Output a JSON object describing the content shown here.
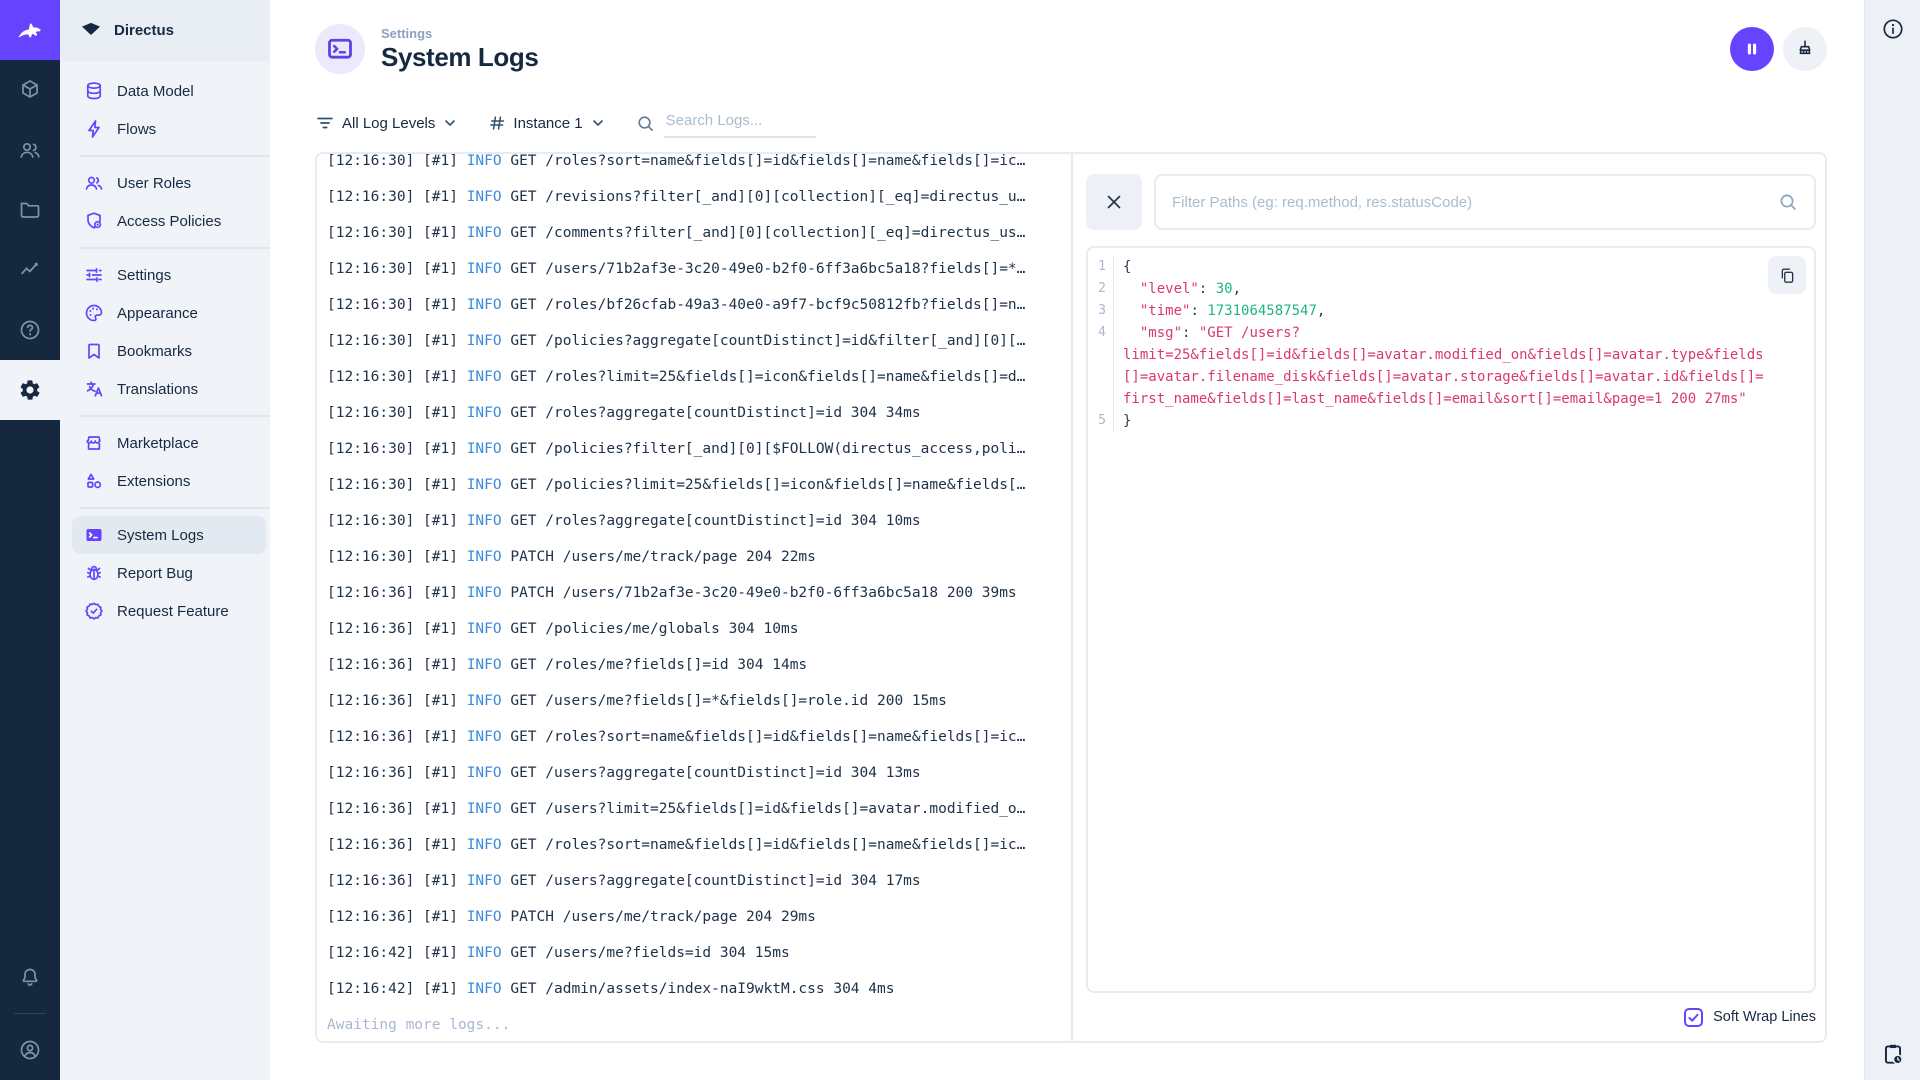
{
  "app": {
    "accent_color": "#6644FF",
    "navy_color": "#172940"
  },
  "module_rail": {
    "modules": [
      {
        "icon": "box-icon",
        "active": false
      },
      {
        "icon": "people-icon",
        "active": false
      },
      {
        "icon": "folder-icon",
        "active": false
      },
      {
        "icon": "insights-icon",
        "active": false
      },
      {
        "icon": "help-icon",
        "active": false
      },
      {
        "icon": "gear-icon",
        "active": true
      }
    ],
    "bottom_icons": [
      "bell-icon",
      "avatar-icon"
    ]
  },
  "nav": {
    "project_name": "Directus",
    "items": [
      {
        "label": "Data Model",
        "icon": "database-icon",
        "active": false
      },
      {
        "label": "Flows",
        "icon": "bolt-icon",
        "active": false
      },
      {
        "label": "User Roles",
        "icon": "user-roles-icon",
        "active": false
      },
      {
        "label": "Access Policies",
        "icon": "shield-icon",
        "active": false
      },
      {
        "label": "Settings",
        "icon": "tune-icon",
        "active": false
      },
      {
        "label": "Appearance",
        "icon": "palette-icon",
        "active": false
      },
      {
        "label": "Bookmarks",
        "icon": "bookmark-icon",
        "active": false
      },
      {
        "label": "Translations",
        "icon": "translate-icon",
        "active": false
      },
      {
        "label": "Marketplace",
        "icon": "storefront-icon",
        "active": false
      },
      {
        "label": "Extensions",
        "icon": "shapes-icon",
        "active": false
      },
      {
        "label": "System Logs",
        "icon": "terminal-icon",
        "active": true
      },
      {
        "label": "Report Bug",
        "icon": "bug-icon",
        "active": false
      },
      {
        "label": "Request Feature",
        "icon": "seal-check-icon",
        "active": false
      }
    ]
  },
  "header": {
    "eyebrow": "Settings",
    "title": "System Logs",
    "actions": [
      {
        "icon": "pause-icon"
      },
      {
        "icon": "broom-icon"
      }
    ]
  },
  "toolbar": {
    "level_filter_label": "All Log Levels",
    "instance_filter_label": "Instance 1",
    "search_placeholder": "Search Logs..."
  },
  "logs": {
    "awaiting_text": "Awaiting more logs...",
    "entries": [
      {
        "time": "[12:16:30]",
        "instance": "[#1]",
        "level": "INFO",
        "message": "GET /roles?sort=name&fields[]=id&fields[]=name&fields[]=ic…"
      },
      {
        "time": "[12:16:30]",
        "instance": "[#1]",
        "level": "INFO",
        "message": "GET /revisions?filter[_and][0][collection][_eq]=directus_u…"
      },
      {
        "time": "[12:16:30]",
        "instance": "[#1]",
        "level": "INFO",
        "message": "GET /comments?filter[_and][0][collection][_eq]=directus_us…"
      },
      {
        "time": "[12:16:30]",
        "instance": "[#1]",
        "level": "INFO",
        "message": "GET /users/71b2af3e-3c20-49e0-b2f0-6ff3a6bc5a18?fields[]=*…"
      },
      {
        "time": "[12:16:30]",
        "instance": "[#1]",
        "level": "INFO",
        "message": "GET /roles/bf26cfab-49a3-40e0-a9f7-bcf9c50812fb?fields[]=n…"
      },
      {
        "time": "[12:16:30]",
        "instance": "[#1]",
        "level": "INFO",
        "message": "GET /policies?aggregate[countDistinct]=id&filter[_and][0][…"
      },
      {
        "time": "[12:16:30]",
        "instance": "[#1]",
        "level": "INFO",
        "message": "GET /roles?limit=25&fields[]=icon&fields[]=name&fields[]=d…"
      },
      {
        "time": "[12:16:30]",
        "instance": "[#1]",
        "level": "INFO",
        "message": "GET /roles?aggregate[countDistinct]=id 304 34ms"
      },
      {
        "time": "[12:16:30]",
        "instance": "[#1]",
        "level": "INFO",
        "message": "GET /policies?filter[_and][0][$FOLLOW(directus_access,poli…"
      },
      {
        "time": "[12:16:30]",
        "instance": "[#1]",
        "level": "INFO",
        "message": "GET /policies?limit=25&fields[]=icon&fields[]=name&fields[…"
      },
      {
        "time": "[12:16:30]",
        "instance": "[#1]",
        "level": "INFO",
        "message": "GET /roles?aggregate[countDistinct]=id 304 10ms"
      },
      {
        "time": "[12:16:30]",
        "instance": "[#1]",
        "level": "INFO",
        "message": "PATCH /users/me/track/page 204 22ms"
      },
      {
        "time": "[12:16:36]",
        "instance": "[#1]",
        "level": "INFO",
        "message": "PATCH /users/71b2af3e-3c20-49e0-b2f0-6ff3a6bc5a18 200 39ms"
      },
      {
        "time": "[12:16:36]",
        "instance": "[#1]",
        "level": "INFO",
        "message": "GET /policies/me/globals 304 10ms"
      },
      {
        "time": "[12:16:36]",
        "instance": "[#1]",
        "level": "INFO",
        "message": "GET /roles/me?fields[]=id 304 14ms"
      },
      {
        "time": "[12:16:36]",
        "instance": "[#1]",
        "level": "INFO",
        "message": "GET /users/me?fields[]=*&fields[]=role.id 200 15ms"
      },
      {
        "time": "[12:16:36]",
        "instance": "[#1]",
        "level": "INFO",
        "message": "GET /roles?sort=name&fields[]=id&fields[]=name&fields[]=ic…"
      },
      {
        "time": "[12:16:36]",
        "instance": "[#1]",
        "level": "INFO",
        "message": "GET /users?aggregate[countDistinct]=id 304 13ms"
      },
      {
        "time": "[12:16:36]",
        "instance": "[#1]",
        "level": "INFO",
        "message": "GET /users?limit=25&fields[]=id&fields[]=avatar.modified_o…"
      },
      {
        "time": "[12:16:36]",
        "instance": "[#1]",
        "level": "INFO",
        "message": "GET /roles?sort=name&fields[]=id&fields[]=name&fields[]=ic…"
      },
      {
        "time": "[12:16:36]",
        "instance": "[#1]",
        "level": "INFO",
        "message": "GET /users?aggregate[countDistinct]=id 304 17ms"
      },
      {
        "time": "[12:16:36]",
        "instance": "[#1]",
        "level": "INFO",
        "message": "PATCH /users/me/track/page 204 29ms"
      },
      {
        "time": "[12:16:42]",
        "instance": "[#1]",
        "level": "INFO",
        "message": "GET /users/me?fields=id 304 15ms"
      },
      {
        "time": "[12:16:42]",
        "instance": "[#1]",
        "level": "INFO",
        "message": "GET /admin/assets/index-naI9wktM.css 304 4ms"
      }
    ]
  },
  "detail": {
    "filter_placeholder": "Filter Paths (eg: req.method, res.statusCode)",
    "soft_wrap_label": "Soft Wrap Lines",
    "soft_wrap_checked": true,
    "code_lines": [
      {
        "num": "1",
        "tokens": [
          {
            "c": "p",
            "t": "{"
          }
        ]
      },
      {
        "num": "2",
        "tokens": [
          {
            "c": "p",
            "t": "  "
          },
          {
            "c": "k",
            "t": "\"level\""
          },
          {
            "c": "p",
            "t": ": "
          },
          {
            "c": "n",
            "t": "30"
          },
          {
            "c": "p",
            "t": ","
          }
        ]
      },
      {
        "num": "3",
        "tokens": [
          {
            "c": "p",
            "t": "  "
          },
          {
            "c": "k",
            "t": "\"time\""
          },
          {
            "c": "p",
            "t": ": "
          },
          {
            "c": "n",
            "t": "1731064587547"
          },
          {
            "c": "p",
            "t": ","
          }
        ]
      },
      {
        "num": "4",
        "tokens": [
          {
            "c": "p",
            "t": "  "
          },
          {
            "c": "k",
            "t": "\"msg\""
          },
          {
            "c": "p",
            "t": ": "
          },
          {
            "c": "s",
            "t": "\"GET /users?"
          }
        ]
      },
      {
        "num": "",
        "tokens": [
          {
            "c": "s",
            "t": "limit=25&fields[]=id&fields[]=avatar.modified_on&fields[]=avatar.type&fields"
          }
        ]
      },
      {
        "num": "",
        "tokens": [
          {
            "c": "s",
            "t": "[]=avatar.filename_disk&fields[]=avatar.storage&fields[]=avatar.id&fields[]="
          }
        ]
      },
      {
        "num": "",
        "tokens": [
          {
            "c": "s",
            "t": "first_name&fields[]=last_name&fields[]=email&sort[]=email&page=1 200 27ms\""
          }
        ]
      },
      {
        "num": "5",
        "tokens": [
          {
            "c": "p",
            "t": "}"
          }
        ]
      }
    ]
  },
  "right_rail": {
    "icons": [
      "info-icon",
      "clipboard-clock-icon"
    ]
  }
}
